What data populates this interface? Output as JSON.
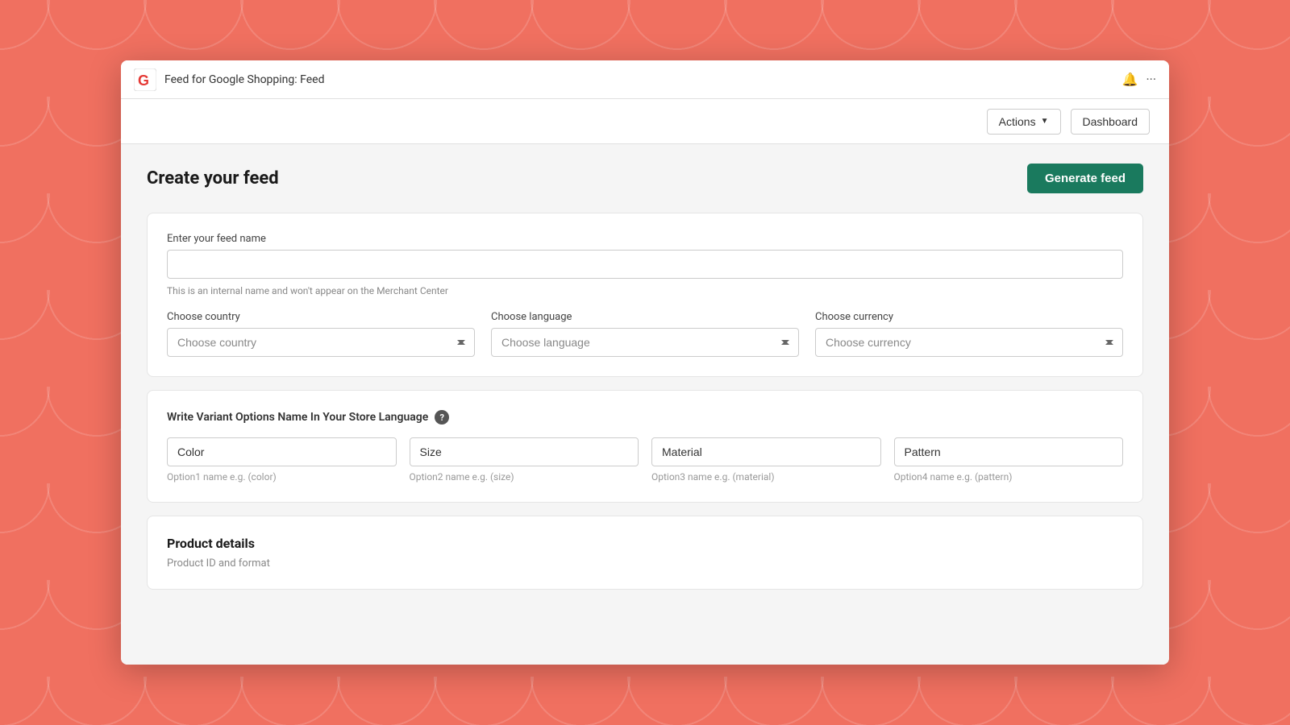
{
  "titleBar": {
    "title": "Feed for Google Shopping: Feed",
    "bellIcon": "🔔",
    "moreIcon": "···"
  },
  "toolbar": {
    "actionsLabel": "Actions",
    "dashboardLabel": "Dashboard"
  },
  "page": {
    "title": "Create your feed",
    "generateButtonLabel": "Generate feed"
  },
  "feedNameCard": {
    "fieldLabel": "Enter your feed name",
    "placeholder": "",
    "helperText": "This is an internal name and won't appear on the Merchant Center",
    "countrySelect": {
      "label": "Choose country",
      "placeholder": "Choose country"
    },
    "languageSelect": {
      "label": "Choose language",
      "placeholder": "Choose language"
    },
    "currencySelect": {
      "label": "Choose currency",
      "placeholder": "Choose currency"
    }
  },
  "variantCard": {
    "title": "Write Variant Options Name In Your Store Language",
    "options": [
      {
        "value": "Color",
        "hint": "Option1 name e.g. (color)"
      },
      {
        "value": "Size",
        "hint": "Option2 name e.g. (size)"
      },
      {
        "value": "Material",
        "hint": "Option3 name e.g. (material)"
      },
      {
        "value": "Pattern",
        "hint": "Option4 name e.g. (pattern)"
      }
    ]
  },
  "productDetailsCard": {
    "title": "Product details",
    "subtitle": "Product ID and format"
  }
}
